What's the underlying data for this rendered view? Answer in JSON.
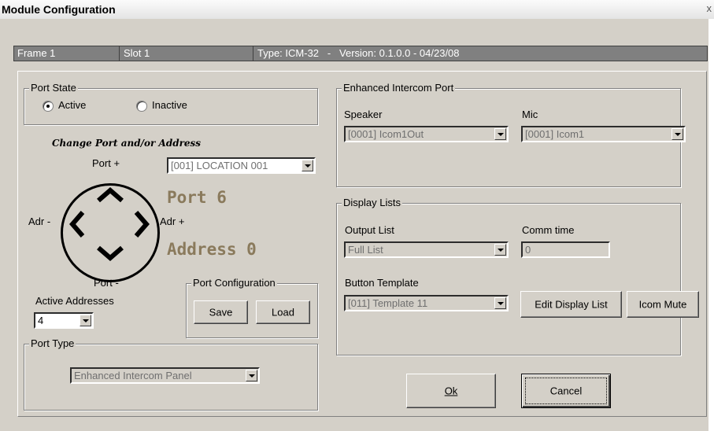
{
  "window": {
    "title": "Module Configuration",
    "close_glyph": "x"
  },
  "infobar": {
    "frame": "Frame 1",
    "slot": "Slot 1",
    "type_version": "Type: ICM-32   -   Version: 0.1.0.0 - 04/23/08"
  },
  "port_state": {
    "label": "Port State",
    "active": "Active",
    "inactive": "Inactive",
    "selected": "Active"
  },
  "change_port": {
    "heading": "Change Port and/or Address",
    "port_plus": "Port +",
    "port_minus": "Port -",
    "adr_minus": "Adr -",
    "adr_plus": "Adr +",
    "location_value": "[001] LOCATION 001",
    "port_display": "Port 6",
    "address_display": "Address 0"
  },
  "active_addresses": {
    "label": "Active Addresses",
    "value": "4"
  },
  "port_configuration": {
    "label": "Port Configuration",
    "save": "Save",
    "load": "Load"
  },
  "port_type": {
    "label": "Port Type",
    "value": "Enhanced Intercom Panel"
  },
  "enhanced_intercom": {
    "label": "Enhanced Intercom Port",
    "speaker_label": "Speaker",
    "speaker_value": "[0001] Icom1Out",
    "mic_label": "Mic",
    "mic_value": "[0001] Icom1"
  },
  "display_lists": {
    "label": "Display Lists",
    "output_list_label": "Output List",
    "output_list_value": "Full List",
    "comm_time_label": "Comm time",
    "comm_time_value": "0",
    "button_template_label": "Button Template",
    "button_template_value": "[011] Template 11",
    "edit_display_list": "Edit Display List",
    "icom_mute": "Icom Mute"
  },
  "footer": {
    "ok": "Ok",
    "cancel": "Cancel"
  },
  "icons": {
    "up": "chevron-up-icon",
    "down": "chevron-down-icon",
    "left": "chevron-left-icon",
    "right": "chevron-right-icon"
  }
}
